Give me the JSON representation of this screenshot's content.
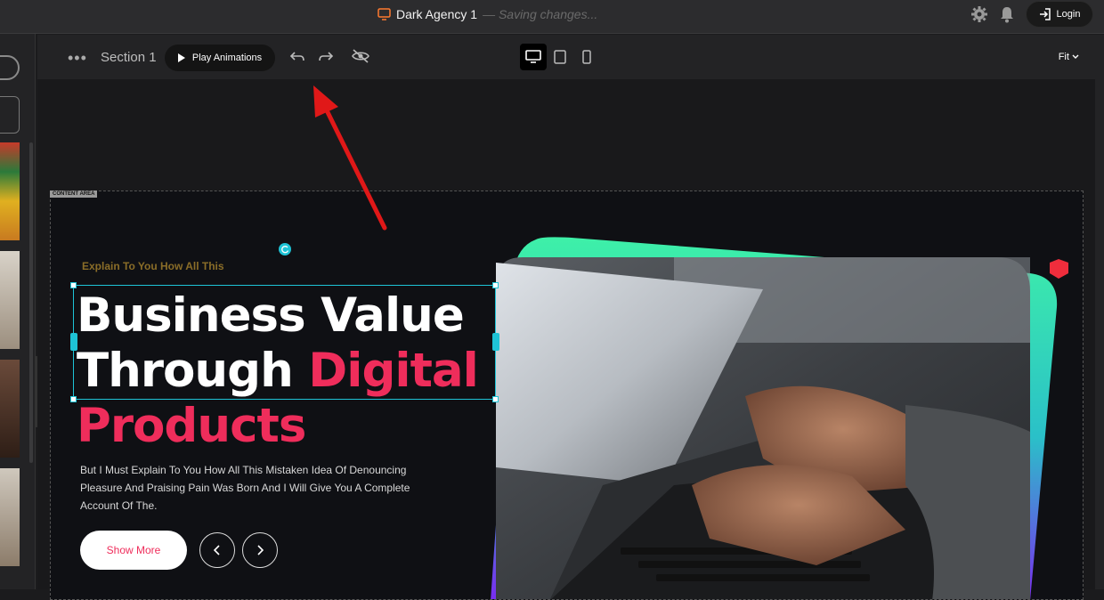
{
  "app": {
    "title": "Dark Agency 1",
    "saving_status": "— Saving changes...",
    "login_label": "Login"
  },
  "toolbar": {
    "section_label": "Section 1",
    "play_label": "Play Animations",
    "fit_label": "Fit"
  },
  "canvas": {
    "content_area_tag": "CONTENT AREA"
  },
  "hero": {
    "eyebrow": "Explain To You How All This",
    "headline_line1": "Business Value",
    "headline_line2": "Through",
    "headline_line2_accent": "Digital",
    "headline_line3": "Products",
    "description": "But I Must Explain To You How All This Mistaken Idea Of Denouncing Pleasure And Praising Pain Was Born And I Will Give You A Complete Account Of The.",
    "cta_label": "Show More"
  },
  "colors": {
    "accent_pink": "#ef2d5b",
    "selection_cyan": "#1ec3d6",
    "eyebrow_gold": "#8a6d28",
    "annotation_red": "#e01818"
  }
}
